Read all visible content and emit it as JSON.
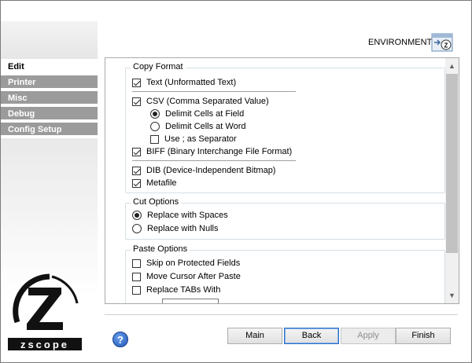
{
  "header": {
    "environment_label": "ENVIRONMENT"
  },
  "sidebar": {
    "items": [
      {
        "label": "Edit",
        "active": true
      },
      {
        "label": "Printer",
        "active": false
      },
      {
        "label": "Misc",
        "active": false
      },
      {
        "label": "Debug",
        "active": false
      },
      {
        "label": "Config Setup",
        "active": false
      }
    ],
    "logo_text": "zscope"
  },
  "copy_format": {
    "title": "Copy Format",
    "text": {
      "label": "Text (Unformatted Text)",
      "checked": true
    },
    "csv": {
      "label": "CSV (Comma Separated Value)",
      "checked": true
    },
    "delimit_field": {
      "label": "Delimit Cells at Field",
      "selected": true
    },
    "delimit_word": {
      "label": "Delimit Cells at Word",
      "selected": false
    },
    "use_separator": {
      "label": "Use ; as Separator",
      "checked": false
    },
    "biff": {
      "label": "BIFF (Binary Interchange File Format)",
      "checked": true
    },
    "dib": {
      "label": "DIB (Device-Independent Bitmap)",
      "checked": true
    },
    "metafile": {
      "label": "Metafile",
      "checked": true
    }
  },
  "cut_options": {
    "title": "Cut Options",
    "spaces": {
      "label": "Replace with Spaces",
      "selected": true
    },
    "nulls": {
      "label": "Replace with Nulls",
      "selected": false
    }
  },
  "paste_options": {
    "title": "Paste Options",
    "skip_protected": {
      "label": "Skip on Protected Fields",
      "checked": false
    },
    "move_cursor": {
      "label": "Move Cursor After Paste",
      "checked": false
    },
    "replace_tabs": {
      "label": "Replace TABs With",
      "checked": false
    }
  },
  "buttons": {
    "main": "Main",
    "back": "Back",
    "apply": "Apply",
    "finish": "Finish",
    "help": "?"
  }
}
